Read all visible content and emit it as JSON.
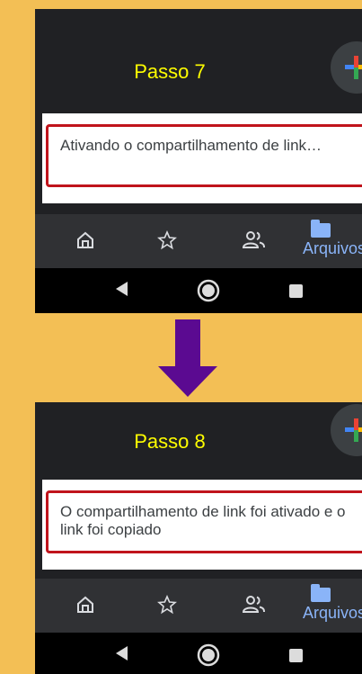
{
  "steps": [
    {
      "title": "Passo 7",
      "message": "Ativando o compartilhamento de link…",
      "nav_files_label": "Arquivos"
    },
    {
      "title": "Passo 8",
      "message": "O compartilhamento de link foi ativado e o link foi copiado",
      "nav_files_label": "Arquivos"
    }
  ],
  "icons": {
    "fab": "plus-icon",
    "nav": [
      "home-icon",
      "star-icon",
      "shared-people-icon",
      "folder-icon"
    ],
    "system": [
      "back-icon",
      "home-circle-icon",
      "recents-icon"
    ],
    "arrow": "down-arrow-icon"
  },
  "colors": {
    "background": "#f3bf55",
    "title": "#ffff00",
    "highlight_border": "#c0141c",
    "arrow": "#5b0a91",
    "accent": "#8ab4f8"
  }
}
